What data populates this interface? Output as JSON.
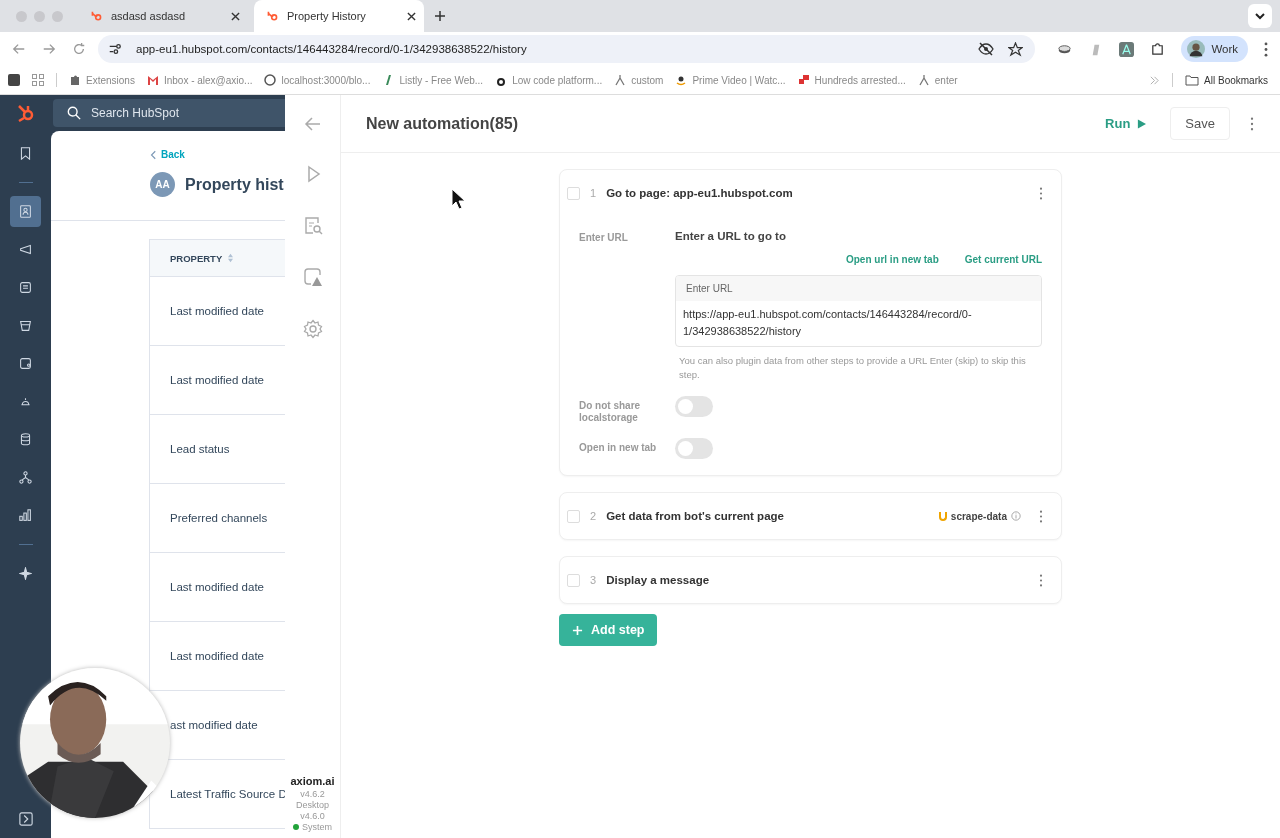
{
  "browser": {
    "tabs": [
      {
        "title": "asdasd asdasd",
        "selected": false
      },
      {
        "title": "Property History",
        "selected": true
      }
    ],
    "address": "app-eu1.hubspot.com/contacts/146443284/record/0-1/342938638522/history",
    "profile": "Work",
    "bookmarks": [
      "Extensions",
      "Inbox - alex@axio...",
      "localhost:3000/blo...",
      "Listly - Free Web...",
      "Low code platform...",
      "custom",
      "Prime Video | Watc...",
      "Hundreds arrested...",
      "enter"
    ],
    "all_bookmarks": "All Bookmarks"
  },
  "hubspot": {
    "search": {
      "placeholder": "Search HubSpot"
    },
    "nav": [
      {
        "selected": false
      },
      {
        "selected": true
      },
      {
        "selected": false
      },
      {
        "selected": false
      },
      {
        "selected": false
      },
      {
        "selected": false
      },
      {
        "selected": false
      },
      {
        "selected": false
      },
      {
        "selected": false
      },
      {
        "selected": false
      },
      {
        "selected": false
      }
    ],
    "back": "Back",
    "avatar": "AA",
    "title": "Property hist",
    "table": {
      "columns": [
        "PROPERTY"
      ],
      "rows": [
        "Last modified date",
        "Last modified date",
        "Lead status",
        "Preferred channels",
        "Last modified date",
        "Last modified date",
        "ast modified date",
        "Latest Traffic Source D"
      ]
    }
  },
  "axiom": {
    "name": "axiom.ai",
    "version": "v4.6.2",
    "desktop": "Desktop",
    "desktop_version": "v4.6.0",
    "status": {
      "label": "System",
      "color": "#22a33a"
    },
    "title": "New automation(85)",
    "run": "Run",
    "save": "Save",
    "steps": [
      {
        "number": "1",
        "title": "Go to page: app-eu1.hubspot.com",
        "checked": false,
        "expanded": true,
        "url_label": "Enter URL",
        "url_heading": "Enter a URL to go to",
        "links": [
          "Open url in new tab",
          "Get current URL"
        ],
        "field": {
          "label": "Enter URL",
          "value": "https://app-eu1.hubspot.com/contacts/146443284/record/0-1/342938638522/history"
        },
        "help": "You can also plugin data from other steps to provide a URL Enter (skip) to skip this step.",
        "toggles": [
          {
            "label": "Do not share localstorage",
            "on": false
          },
          {
            "label": "Open in new tab",
            "on": false
          }
        ]
      },
      {
        "number": "2",
        "title": "Get data from bot's current page",
        "checked": false,
        "expanded": false,
        "tag": "scrape-data"
      },
      {
        "number": "3",
        "title": "Display a message",
        "checked": false,
        "expanded": false
      }
    ],
    "add_step": "Add step"
  }
}
